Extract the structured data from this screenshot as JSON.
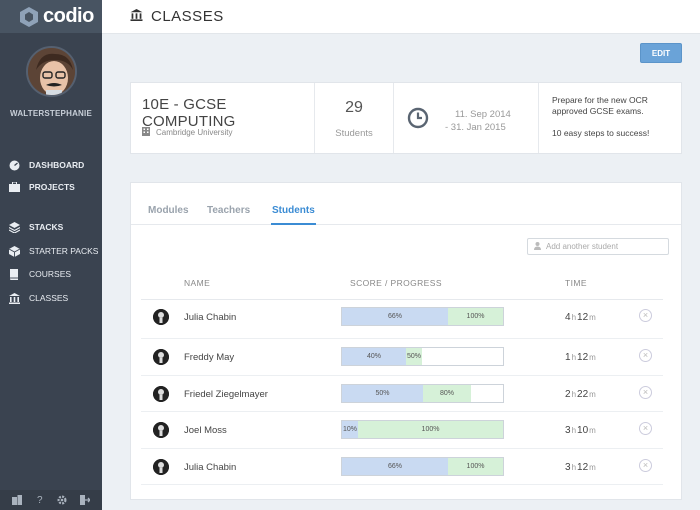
{
  "app": {
    "logo": "codio"
  },
  "user": {
    "name": "WALTERSTEPHANIE"
  },
  "sidebar": {
    "items": [
      {
        "label": "DASHBOARD",
        "icon": "dashboard-icon"
      },
      {
        "label": "PROJECTS",
        "icon": "briefcase-icon"
      },
      {
        "label": "STACKS",
        "icon": "stack-icon"
      },
      {
        "label": "STARTER PACKS",
        "icon": "box-icon"
      },
      {
        "label": "COURSES",
        "icon": "book-icon"
      },
      {
        "label": "CLASSES",
        "icon": "bank-icon"
      }
    ],
    "bottom_icons": [
      "building-icon",
      "help-icon",
      "gear-icon",
      "logout-icon"
    ]
  },
  "header": {
    "title": "CLASSES",
    "icon": "bank-icon"
  },
  "toolbar": {
    "edit_label": "EDIT"
  },
  "class_info": {
    "title": "10E - GCSE COMPUTING",
    "organization": "Cambridge University",
    "students_count": "29",
    "students_label": "Students",
    "start_date": "11. Sep 2014",
    "end_date": "- 31. Jan 2015",
    "description_line1": "Prepare for the new OCR",
    "description_line2": "approved GCSE exams.",
    "description_line3": "10 easy steps to success!"
  },
  "tabs": [
    {
      "label": "Modules",
      "active": false
    },
    {
      "label": "Teachers",
      "active": false
    },
    {
      "label": "Students",
      "active": true
    }
  ],
  "search": {
    "placeholder": "Add another student"
  },
  "table": {
    "columns": [
      "NAME",
      "SCORE / PROGRESS",
      "TIME"
    ],
    "rows": [
      {
        "name": "Julia Chabin",
        "score": 66,
        "progress": 100,
        "score_label": "66%",
        "progress_label": "100%",
        "hours": "4",
        "minutes": "12"
      },
      {
        "name": "Freddy May",
        "score": 40,
        "progress": 50,
        "score_label": "40%",
        "progress_label": "50%",
        "hours": "1",
        "minutes": "12"
      },
      {
        "name": "Friedel Ziegelmayer",
        "score": 50,
        "progress": 80,
        "score_label": "50%",
        "progress_label": "80%",
        "hours": "2",
        "minutes": "22"
      },
      {
        "name": "Joel Moss",
        "score": 10,
        "progress": 100,
        "score_label": "10%",
        "progress_label": "100%",
        "hours": "3",
        "minutes": "10"
      },
      {
        "name": "Julia Chabin",
        "score": 66,
        "progress": 100,
        "score_label": "66%",
        "progress_label": "100%",
        "hours": "3",
        "minutes": "12"
      }
    ],
    "hour_unit": "h",
    "minute_unit": "m"
  },
  "colors": {
    "accent": "#3b8cd4",
    "sidebar_bg": "#3a4350",
    "score": "#c9daf2",
    "progress": "#d6f1d8"
  }
}
